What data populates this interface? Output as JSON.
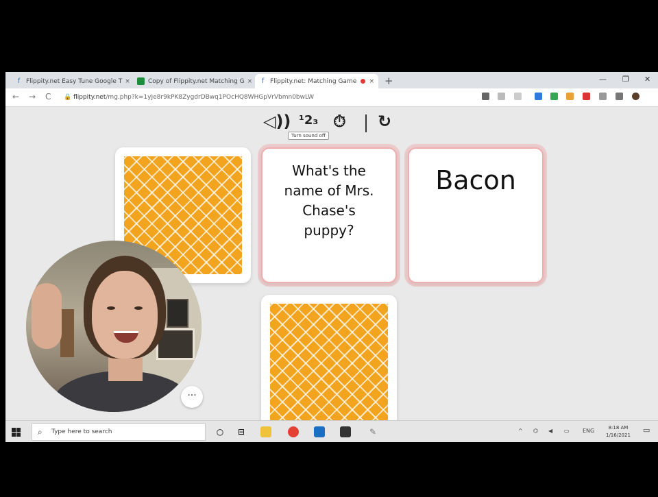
{
  "browser": {
    "tabs": [
      {
        "title": "Flippity.net Easy Tune Google T",
        "active": false
      },
      {
        "title": "Copy of Flippity.net Matching G",
        "active": false
      },
      {
        "title": "Flippity.net: Matching Game",
        "active": true
      }
    ],
    "new_tab_label": "+",
    "close_label": "×",
    "window_controls": [
      "—",
      "❐",
      "✕"
    ],
    "url_host": "flippity.net",
    "url_path": "/mg.php?k=1yJe8r9kPK8ZygdrDBwq1POcHQ8WHGpVrVbmn0bwLW"
  },
  "game": {
    "sound_icon_label": "◁))",
    "numbers_icon_label": "¹2₃",
    "timer_icon_label": "⏱",
    "restart_icon_label": "↻",
    "tooltip": "Turn sound off",
    "cards": [
      {
        "state": "face-down"
      },
      {
        "state": "face-up",
        "text": "What's the name of Mrs. Chase's puppy?"
      },
      {
        "state": "face-up",
        "text": "Bacon"
      },
      {
        "state": "face-down"
      }
    ]
  },
  "webcam": {
    "more_button_label": "···"
  },
  "taskbar": {
    "search_placeholder": "Type here to search",
    "language": "ENG",
    "time": "8:18 AM",
    "date": "1/16/2021"
  },
  "colors": {
    "card_pattern": "#f2a41f",
    "card_highlight": "#f0b0b0",
    "background": "#e9e9e9"
  }
}
